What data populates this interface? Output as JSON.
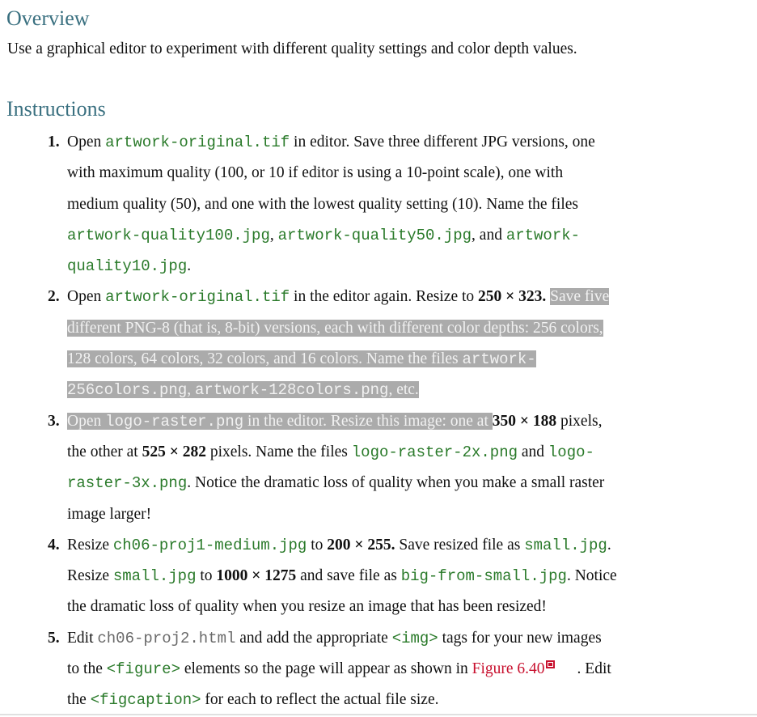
{
  "overview": {
    "heading": "Overview",
    "text": "Use a graphical editor to experiment with different quality settings and color depth values."
  },
  "instructions": {
    "heading": "Instructions",
    "steps": [
      {
        "number": "1.",
        "lines": [
          [
            {
              "t": "Open "
            },
            {
              "c": "artwork-original.tif"
            },
            {
              "t": " in editor. Save three different JPG versions, one"
            }
          ],
          [
            {
              "t": "with maximum quality (100, or 10 if editor is using a 10-point scale), one with"
            }
          ],
          [
            {
              "t": "medium quality (50), and one with the lowest quality setting (10). Name the files"
            }
          ],
          [
            {
              "c": "artwork-quality100.jpg"
            },
            {
              "t": ", "
            },
            {
              "c": "artwork-quality50.jpg"
            },
            {
              "t": ", and "
            },
            {
              "c": "artwork-"
            }
          ],
          [
            {
              "c": "quality10.jpg"
            },
            {
              "t": "."
            }
          ]
        ]
      },
      {
        "number": "2.",
        "lines": [
          [
            {
              "t": "Open "
            },
            {
              "c": "artwork-original.tif"
            },
            {
              "t": " in the editor again. Resize to "
            },
            {
              "b": "250 × 323."
            },
            {
              "t": " "
            },
            {
              "s": "Save five "
            }
          ],
          [
            {
              "s": "different PNG-8 (that is, 8-bit) versions, each with different color depths: 256 colors, "
            }
          ],
          [
            {
              "s": "128 colors, 64 colors, 32 colors, and 16 colors. Name the files "
            },
            {
              "sc": "artwork-"
            }
          ],
          [
            {
              "sc": "256colors.png"
            },
            {
              "s": ", "
            },
            {
              "sc": "artwork-128colors.png"
            },
            {
              "s": ", etc."
            }
          ]
        ]
      },
      {
        "number": "3.",
        "lines": [
          [
            {
              "s": "Open "
            },
            {
              "sc": "logo-raster.png"
            },
            {
              "s": " in the editor. Resize this image: one at "
            },
            {
              "b": "350 × 188"
            },
            {
              "t": " pixels,"
            }
          ],
          [
            {
              "t": "the other at "
            },
            {
              "b": "525 × 282"
            },
            {
              "t": " pixels. Name the files "
            },
            {
              "c": "logo-raster-2x.png"
            },
            {
              "t": " and "
            },
            {
              "c": "logo-"
            }
          ],
          [
            {
              "c": "raster-3x.png"
            },
            {
              "t": ". Notice the dramatic loss of quality when you make a small raster"
            }
          ],
          [
            {
              "t": "image larger!"
            }
          ]
        ]
      },
      {
        "number": "4.",
        "lines": [
          [
            {
              "t": "Resize "
            },
            {
              "c": "ch06-proj1-medium.jpg"
            },
            {
              "t": " to "
            },
            {
              "b": "200 × 255."
            },
            {
              "t": " Save resized file as "
            },
            {
              "c": "small.jpg"
            },
            {
              "t": "."
            }
          ],
          [
            {
              "t": "Resize "
            },
            {
              "c": "small.jpg"
            },
            {
              "t": " to "
            },
            {
              "b": "1000 × 1275"
            },
            {
              "t": " and save file as "
            },
            {
              "c": "big-from-small.jpg"
            },
            {
              "t": ". Notice"
            }
          ],
          [
            {
              "t": "the dramatic loss of quality when you resize an image that has been resized!"
            }
          ]
        ]
      },
      {
        "number": "5.",
        "lines": [
          [
            {
              "t": "Edit "
            },
            {
              "g": "ch06-proj2.html"
            },
            {
              "t": " and add the appropriate "
            },
            {
              "c": "<img>"
            },
            {
              "t": " tags for your new images"
            }
          ],
          [
            {
              "t": "to the "
            },
            {
              "c": "<figure>"
            },
            {
              "t": " elements so the page will appear as shown in "
            },
            {
              "l": "Figure 6.40"
            },
            {
              "i": "external-link-icon"
            },
            {
              "t": ". Edit"
            }
          ],
          [
            {
              "t": "the "
            },
            {
              "c": "<figcaption>"
            },
            {
              "t": " for each to reflect the actual file size."
            }
          ]
        ]
      }
    ]
  },
  "colors": {
    "heading": "#3a7080",
    "code": "#2a7a2a",
    "link": "#c8102e",
    "selection": "#ababab"
  }
}
